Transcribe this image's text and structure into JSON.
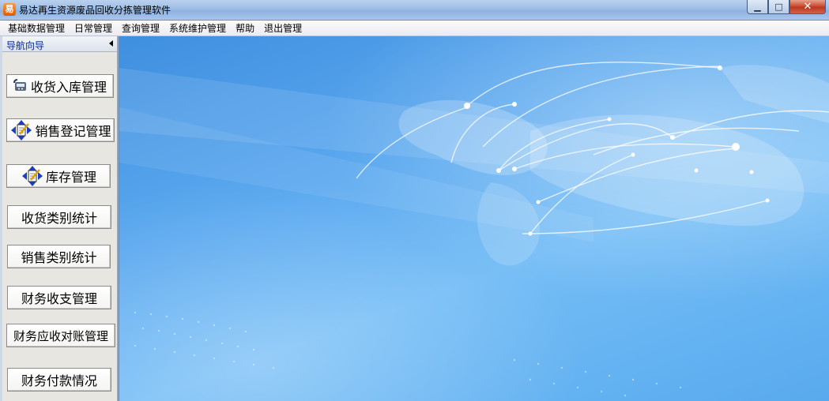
{
  "window": {
    "icon_glyph": "易",
    "title": "易达再生资源废品回收分拣管理软件",
    "min_glyph": "▁",
    "max_glyph": "□",
    "close_glyph": "✕"
  },
  "menu": [
    {
      "label": "基础数据管理"
    },
    {
      "label": "日常管理"
    },
    {
      "label": "查询管理"
    },
    {
      "label": "系统维护管理"
    },
    {
      "label": "帮助"
    },
    {
      "label": "退出管理"
    }
  ],
  "sidebar": {
    "header": "导航向导",
    "buttons": [
      {
        "label": "收货入库管理",
        "icon": "phone-icon"
      },
      {
        "label": "销售登记管理",
        "icon": "edit-arrows-icon"
      },
      {
        "label": "库存管理",
        "icon": "edit-arrows-icon"
      },
      {
        "label": "收货类别统计"
      },
      {
        "label": "销售类别统计"
      },
      {
        "label": "财务收支管理"
      },
      {
        "label": "财务应收对账管理"
      },
      {
        "label": "财务付款情况"
      }
    ]
  },
  "main": {
    "background": "blue-world-map-network-graphic"
  },
  "colors": {
    "titlebar": "#9dbde6",
    "accent": "#3f8fe0",
    "header_text": "#0a2a8a"
  }
}
